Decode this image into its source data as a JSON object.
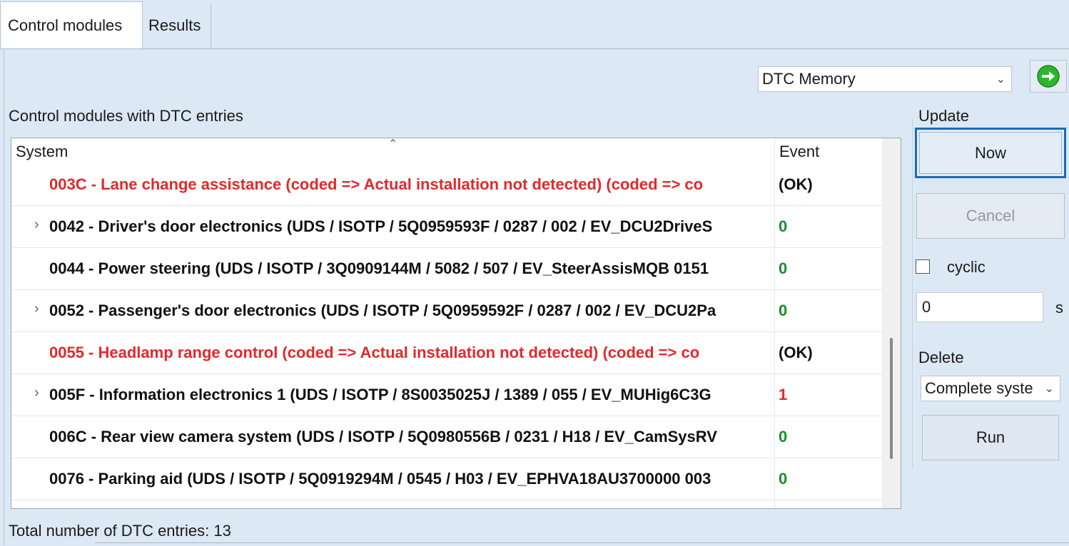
{
  "tabs": [
    {
      "label": "Control modules",
      "active": true
    },
    {
      "label": "Results",
      "active": false
    }
  ],
  "mode_select": {
    "value": "DTC Memory"
  },
  "go_button": {
    "icon": "green-arrow-right-icon",
    "color": "#2db52d"
  },
  "modules_label": "Control modules with DTC entries",
  "table": {
    "headers": {
      "system": "System",
      "event": "Event"
    },
    "rows": [
      {
        "system": "003C - Lane change assistance  (coded => Actual installation not detected)  (coded => co",
        "event": "(OK)",
        "color": "red",
        "event_color": "black",
        "expandable": false
      },
      {
        "system": "0042 - Driver's door electronics  (UDS / ISOTP / 5Q0959593F / 0287 / 002 / EV_DCU2DriveS",
        "event": "0",
        "color": "black",
        "event_color": "green",
        "expandable": true
      },
      {
        "system": "0044 - Power steering  (UDS / ISOTP / 3Q0909144M / 5082 / 507 / EV_SteerAssisMQB 0151",
        "event": "0",
        "color": "black",
        "event_color": "green",
        "expandable": false
      },
      {
        "system": "0052 - Passenger's door electronics  (UDS / ISOTP / 5Q0959592F / 0287 / 002 / EV_DCU2Pa",
        "event": "0",
        "color": "black",
        "event_color": "green",
        "expandable": true
      },
      {
        "system": "0055 - Headlamp range control  (coded => Actual installation not detected)  (coded => co",
        "event": "(OK)",
        "color": "red",
        "event_color": "black",
        "expandable": false
      },
      {
        "system": "005F - Information electronics 1  (UDS / ISOTP / 8S0035025J / 1389 / 055 / EV_MUHig6C3G",
        "event": "1",
        "color": "black",
        "event_color": "red",
        "expandable": true
      },
      {
        "system": "006C - Rear view camera system  (UDS / ISOTP / 5Q0980556B / 0231 / H18 / EV_CamSysRV",
        "event": "0",
        "color": "black",
        "event_color": "green",
        "expandable": false
      },
      {
        "system": "0076 - Parking aid  (UDS / ISOTP / 5Q0919294M / 0545 / H03 / EV_EPHVA18AU3700000 003",
        "event": "0",
        "color": "black",
        "event_color": "green",
        "expandable": false
      }
    ]
  },
  "total": {
    "label": "Total number of DTC entries:",
    "value": "13"
  },
  "update": {
    "label": "Update",
    "now": "Now",
    "cancel": "Cancel",
    "cyclic": "cyclic",
    "cyclic_checked": false,
    "interval_value": "0",
    "unit": "s"
  },
  "delete": {
    "label": "Delete",
    "select_value": "Complete syste",
    "run": "Run"
  }
}
